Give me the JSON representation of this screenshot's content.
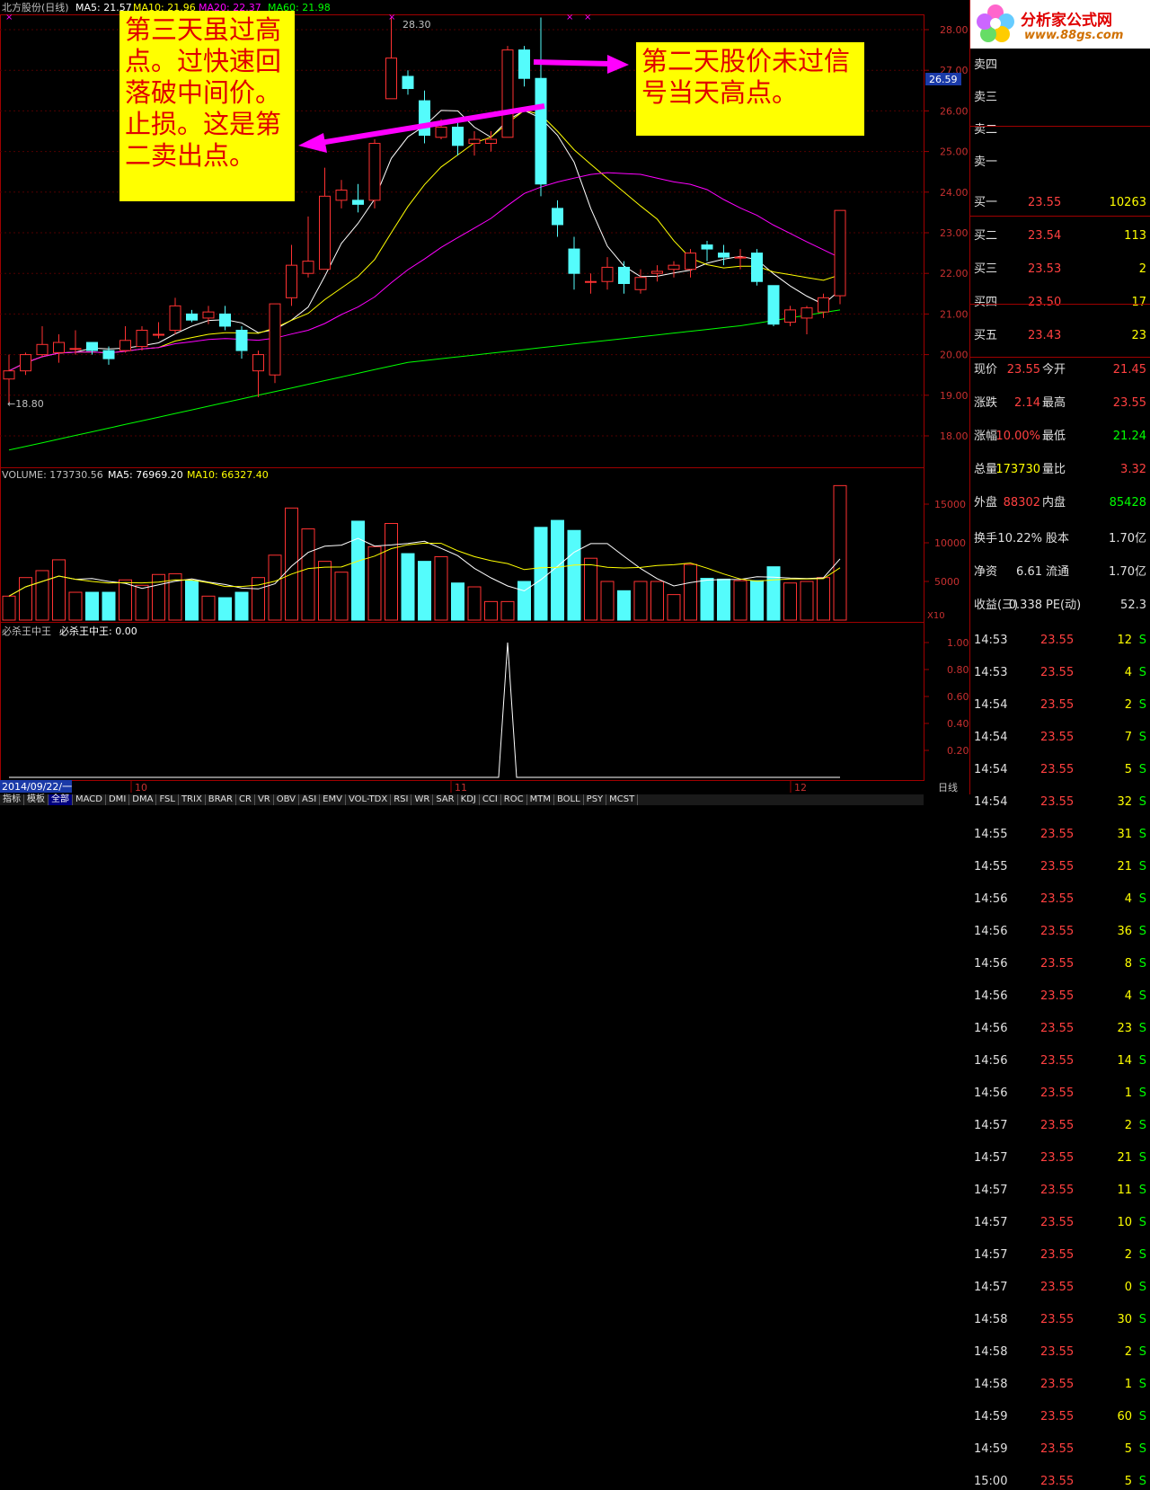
{
  "chart_header": {
    "title": "北方股份(日线)",
    "ma5": "MA5: 21.57",
    "ma10": "MA10: 21.96",
    "ma20": "MA20: 22.37",
    "ma60": "MA60: 21.98",
    "high_label": "28.30",
    "low_label": "18.80",
    "current_price_tag": "26.59"
  },
  "price_axis": [
    "28.00",
    "27.00",
    "26.00",
    "25.00",
    "24.00",
    "23.00",
    "22.00",
    "21.00",
    "20.00",
    "19.00",
    "18.00"
  ],
  "volume_header": {
    "label": "VOLUME: 173730.56",
    "ma5": "MA5: 76969.20",
    "ma10": "MA10: 66327.40",
    "unit": "X10"
  },
  "volume_axis": [
    "15000",
    "10000",
    "5000"
  ],
  "indicator_header": {
    "name": "必杀王中王",
    "value": "必杀王中王: 0.00"
  },
  "indicator_axis": [
    "1.00",
    "0.80",
    "0.60",
    "0.40",
    "0.20"
  ],
  "date_bar": {
    "start_date": "2014/09/22/一",
    "months": [
      "10",
      "11",
      "12"
    ],
    "period": "日线"
  },
  "tabs": [
    "指标",
    "模板",
    "全部",
    "MACD",
    "DMI",
    "DMA",
    "FSL",
    "TRIX",
    "BRAR",
    "CR",
    "VR",
    "OBV",
    "ASI",
    "EMV",
    "VOL-TDX",
    "RSI",
    "WR",
    "SAR",
    "KDJ",
    "CCI",
    "ROC",
    "MTM",
    "BOLL",
    "PSY",
    "MCST"
  ],
  "annotations": {
    "left": "第三天虽过高点。过快速回落破中间价。止损。这是第二卖出点。",
    "right": "第二天股价未过信号当天高点。"
  },
  "logo": {
    "site": "分析家公式网",
    "url": "www.88gs.com"
  },
  "order_book": {
    "sell": [
      {
        "label": "卖四",
        "price": "",
        "vol": ""
      },
      {
        "label": "卖三",
        "price": "",
        "vol": ""
      },
      {
        "label": "卖二",
        "price": "",
        "vol": ""
      },
      {
        "label": "卖一",
        "price": "",
        "vol": ""
      }
    ],
    "buy": [
      {
        "label": "买一",
        "price": "23.55",
        "vol": "10263"
      },
      {
        "label": "买二",
        "price": "23.54",
        "vol": "113"
      },
      {
        "label": "买三",
        "price": "23.53",
        "vol": "2"
      },
      {
        "label": "买四",
        "price": "23.50",
        "vol": "17"
      },
      {
        "label": "买五",
        "price": "23.43",
        "vol": "23"
      }
    ]
  },
  "quote": [
    {
      "l1": "现价",
      "v1": "23.55",
      "c1": "#ff4040",
      "l2": "今开",
      "v2": "21.45",
      "c2": "#ff4040"
    },
    {
      "l1": "涨跌",
      "v1": "2.14",
      "c1": "#ff4040",
      "l2": "最高",
      "v2": "23.55",
      "c2": "#ff4040"
    },
    {
      "l1": "涨幅",
      "v1": "10.00%",
      "c1": "#ff4040",
      "l2": "最低",
      "v2": "21.24",
      "c2": "#00ff00"
    },
    {
      "l1": "总量",
      "v1": "173730",
      "c1": "#ffff00",
      "l2": "量比",
      "v2": "3.32",
      "c2": "#ff4040"
    },
    {
      "l1": "外盘",
      "v1": "88302",
      "c1": "#ff4040",
      "l2": "内盘",
      "v2": "85428",
      "c2": "#00ff00"
    }
  ],
  "stats": [
    {
      "l1": "换手",
      "v1": "10.22%",
      "l2": "股本",
      "v2": "1.70亿"
    },
    {
      "l1": "净资",
      "v1": "6.61",
      "l2": "流通",
      "v2": "1.70亿"
    },
    {
      "l1": "收益(三)",
      "v1": "0.338",
      "l2": "PE(动)",
      "v2": "52.3"
    }
  ],
  "ticks": [
    {
      "t": "14:53",
      "p": "23.55",
      "v": "12",
      "f": "S"
    },
    {
      "t": "14:53",
      "p": "23.55",
      "v": "4",
      "f": "S"
    },
    {
      "t": "14:54",
      "p": "23.55",
      "v": "2",
      "f": "S"
    },
    {
      "t": "14:54",
      "p": "23.55",
      "v": "7",
      "f": "S"
    },
    {
      "t": "14:54",
      "p": "23.55",
      "v": "5",
      "f": "S"
    },
    {
      "t": "14:54",
      "p": "23.55",
      "v": "32",
      "f": "S"
    },
    {
      "t": "14:55",
      "p": "23.55",
      "v": "31",
      "f": "S"
    },
    {
      "t": "14:55",
      "p": "23.55",
      "v": "21",
      "f": "S"
    },
    {
      "t": "14:56",
      "p": "23.55",
      "v": "4",
      "f": "S"
    },
    {
      "t": "14:56",
      "p": "23.55",
      "v": "36",
      "f": "S"
    },
    {
      "t": "14:56",
      "p": "23.55",
      "v": "8",
      "f": "S"
    },
    {
      "t": "14:56",
      "p": "23.55",
      "v": "4",
      "f": "S"
    },
    {
      "t": "14:56",
      "p": "23.55",
      "v": "23",
      "f": "S"
    },
    {
      "t": "14:56",
      "p": "23.55",
      "v": "14",
      "f": "S"
    },
    {
      "t": "14:56",
      "p": "23.55",
      "v": "1",
      "f": "S"
    },
    {
      "t": "14:57",
      "p": "23.55",
      "v": "2",
      "f": "S"
    },
    {
      "t": "14:57",
      "p": "23.55",
      "v": "21",
      "f": "S"
    },
    {
      "t": "14:57",
      "p": "23.55",
      "v": "11",
      "f": "S"
    },
    {
      "t": "14:57",
      "p": "23.55",
      "v": "10",
      "f": "S"
    },
    {
      "t": "14:57",
      "p": "23.55",
      "v": "2",
      "f": "S"
    },
    {
      "t": "14:57",
      "p": "23.55",
      "v": "0",
      "f": "S"
    },
    {
      "t": "14:58",
      "p": "23.55",
      "v": "30",
      "f": "S"
    },
    {
      "t": "14:58",
      "p": "23.55",
      "v": "2",
      "f": "S"
    },
    {
      "t": "14:58",
      "p": "23.55",
      "v": "1",
      "f": "S"
    },
    {
      "t": "14:59",
      "p": "23.55",
      "v": "60",
      "f": "S"
    },
    {
      "t": "14:59",
      "p": "23.55",
      "v": "5",
      "f": "S"
    },
    {
      "t": "15:00",
      "p": "23.55",
      "v": "5",
      "f": "S"
    }
  ],
  "candles": [
    [
      19.4,
      19.6,
      18.8,
      20.0
    ],
    [
      19.6,
      20.0,
      19.5,
      20.05
    ],
    [
      20.0,
      20.25,
      19.95,
      20.7
    ],
    [
      20.05,
      20.3,
      19.8,
      20.5
    ],
    [
      20.15,
      20.15,
      20.0,
      20.6
    ],
    [
      20.3,
      20.1,
      20.0,
      20.3
    ],
    [
      20.1,
      19.9,
      19.75,
      20.2
    ],
    [
      20.1,
      20.35,
      20.05,
      20.7
    ],
    [
      20.2,
      20.6,
      20.1,
      20.7
    ],
    [
      20.5,
      20.5,
      20.4,
      20.8
    ],
    [
      20.6,
      21.2,
      20.5,
      21.4
    ],
    [
      21.0,
      20.85,
      20.8,
      21.1
    ],
    [
      20.9,
      21.05,
      20.75,
      21.2
    ],
    [
      21.0,
      20.7,
      20.6,
      21.2
    ],
    [
      20.6,
      20.1,
      19.9,
      20.7
    ],
    [
      19.6,
      20.0,
      18.95,
      20.1
    ],
    [
      19.5,
      21.25,
      19.3,
      21.25
    ],
    [
      21.4,
      22.2,
      21.2,
      22.7
    ],
    [
      22.0,
      22.3,
      21.9,
      23.4
    ],
    [
      22.1,
      23.9,
      22.1,
      24.6
    ],
    [
      23.8,
      24.05,
      23.6,
      24.3
    ],
    [
      23.8,
      23.7,
      23.5,
      24.2
    ],
    [
      23.8,
      25.2,
      23.6,
      25.3
    ],
    [
      26.3,
      27.3,
      26.3,
      28.3
    ],
    [
      26.85,
      26.55,
      26.4,
      27.0
    ],
    [
      26.25,
      25.4,
      25.2,
      26.5
    ],
    [
      25.35,
      25.6,
      25.3,
      25.8
    ],
    [
      25.6,
      25.15,
      24.9,
      25.7
    ],
    [
      25.2,
      25.3,
      24.9,
      25.5
    ],
    [
      25.2,
      25.3,
      25.0,
      25.5
    ],
    [
      25.35,
      27.5,
      25.35,
      27.6
    ],
    [
      27.5,
      26.8,
      26.6,
      27.6
    ],
    [
      26.8,
      24.2,
      23.9,
      28.3
    ],
    [
      23.6,
      23.2,
      22.9,
      23.8
    ],
    [
      22.6,
      22.0,
      21.6,
      22.9
    ],
    [
      21.8,
      21.8,
      21.5,
      22.0
    ],
    [
      21.8,
      22.15,
      21.6,
      22.4
    ],
    [
      22.15,
      21.75,
      21.5,
      22.3
    ],
    [
      21.6,
      21.9,
      21.5,
      22.1
    ],
    [
      22.0,
      22.05,
      21.8,
      22.2
    ],
    [
      22.1,
      22.2,
      21.9,
      22.3
    ],
    [
      22.1,
      22.5,
      21.9,
      22.6
    ],
    [
      22.7,
      22.6,
      22.3,
      22.8
    ],
    [
      22.5,
      22.4,
      22.2,
      22.7
    ],
    [
      22.4,
      22.4,
      22.1,
      22.6
    ],
    [
      22.5,
      21.8,
      21.7,
      22.6
    ],
    [
      21.7,
      20.75,
      20.7,
      21.7
    ],
    [
      20.8,
      21.1,
      20.7,
      21.2
    ],
    [
      20.9,
      21.15,
      20.5,
      21.2
    ],
    [
      21.05,
      21.4,
      20.9,
      21.5
    ],
    [
      21.45,
      23.55,
      21.24,
      23.55
    ]
  ],
  "volumes": [
    3.1,
    5.5,
    6.4,
    7.8,
    3.6,
    3.6,
    3.6,
    5.2,
    4.5,
    5.9,
    6.0,
    5.1,
    3.1,
    2.9,
    3.6,
    5.5,
    8.4,
    14.5,
    11.8,
    7.6,
    6.2,
    12.8,
    9.5,
    12.5,
    8.6,
    7.6,
    8.2,
    4.8,
    4.3,
    2.4,
    2.4,
    5.0,
    12.0,
    12.9,
    11.6,
    8.0,
    5.0,
    3.8,
    5.0,
    5.0,
    3.3,
    7.2,
    5.4,
    5.3,
    5.1,
    5.1,
    6.9,
    4.8,
    5.0,
    5.5,
    17.4
  ]
}
